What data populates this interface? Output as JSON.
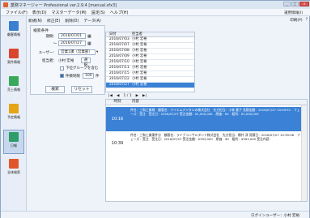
{
  "window": {
    "title": "業務マネージャー Professional ver.2.9.4 [manual.sfx3]",
    "controls": [
      "_",
      "□",
      "×"
    ]
  },
  "menu": {
    "items": [
      "ファイル(F)",
      "表示(D)",
      "マスターデータ(M)",
      "設定(S)",
      "ヘルプ(H)"
    ],
    "right_label": "運用情報(I)"
  },
  "sidebar": {
    "items": [
      {
        "label": "顧客情報",
        "icon": "customer-card-icon",
        "color": "#3a7fd0"
      },
      {
        "label": "案件情報",
        "icon": "project-icon",
        "color": "#d9452f"
      },
      {
        "label": "売上情報",
        "icon": "sales-icon",
        "color": "#3aa85a"
      },
      {
        "label": "予定情報",
        "icon": "schedule-icon",
        "color": "#e6a417"
      },
      {
        "label": "日報",
        "icon": "daily-report-icon",
        "color": "#2e9d68"
      },
      {
        "label": "全体検索",
        "icon": "global-search-icon",
        "color": "#e2562b"
      }
    ]
  },
  "toolbar": {
    "new": "新規(N)",
    "edit": "修正(E)",
    "delete": "削除(D)",
    "data": "データ(A)",
    "print": "印刷(P)",
    "help_icon": "?"
  },
  "filter": {
    "header": "検索条件",
    "date_label": "期間：",
    "date_from": "2016/07/01",
    "date_to": "2016/07/27",
    "user_label": "ユーザー：",
    "user_value": "営業1課（営業部）",
    "person_label": "担当者：",
    "person_value": "小村 宏裕",
    "person_btn": "選択",
    "subordinate_label": "下位グループを含む",
    "count_label": "件数制限",
    "count_value": "100",
    "count_unit": "件",
    "search_btn": "検索",
    "reset_btn": "リセット"
  },
  "date_list": {
    "headers": [
      "日付",
      "担当者"
    ],
    "rows": [
      [
        "2016/07/03",
        "小村 宏裕"
      ],
      [
        "2016/07/07",
        "小村 宏裕"
      ],
      [
        "2016/07/08",
        "小村 宏裕"
      ],
      [
        "2016/07/09",
        "小村 宏裕"
      ],
      [
        "2016/07/10",
        "小村 宏裕"
      ],
      [
        "2016/07/11",
        "小村 宏裕"
      ],
      [
        "2016/07/15",
        "小村 宏裕"
      ],
      [
        "2016/07/22",
        "小村 宏裕"
      ],
      [
        "2016/07/27",
        "小村 宏裕"
      ]
    ],
    "selected_index": 8,
    "pager": [
      "|◀",
      "◀",
      "1 / 1",
      "▶",
      "▶|"
    ]
  },
  "detail": {
    "headers": [
      "時刻",
      "内容"
    ],
    "rows": [
      {
        "time": "10:16",
        "text": "件名：三和工業様　顧客名：パイエムデジタルの株式会社　先方担当：小林 寛子 見積金額：2016/07/27 10:09:51　フェーズ：受注　受注日：2016/07/27 受注金額：¥1,000,000　原価：¥0　粗利：¥1,000,000",
        "selected": true
      },
      {
        "time": "10:39",
        "text": "件名：三和工業案件分　顧客名：ライブコンサルタント株式会社　先方担当：横井 淳 見積日：2016/07/27 10:39:56　フェーズ：受注　受注日：2016/07/27 受注金額：¥393,000　原価：¥0　粗利：¥393,000 受注内容：",
        "selected": false
      }
    ]
  },
  "status": {
    "user": "ログインユーザー：小村 宏裕"
  }
}
